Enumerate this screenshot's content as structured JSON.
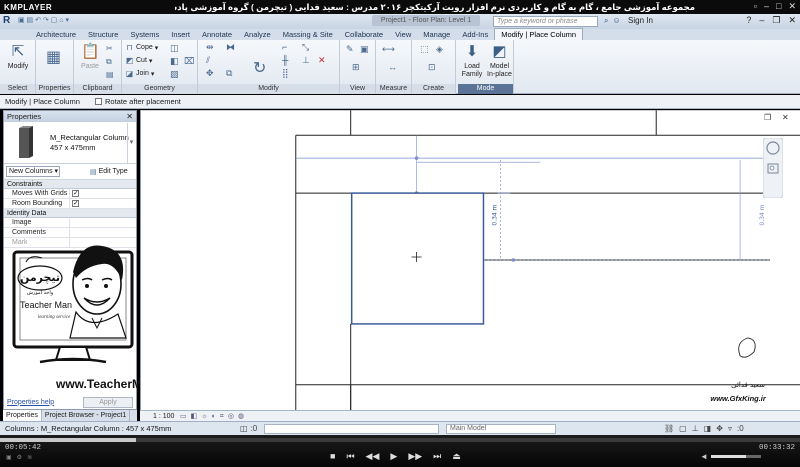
{
  "player": {
    "logo": "KMPLAYER",
    "caption": "مجموعه آموزشی جامع ، گام به گام و کاربردی نرم افزار رویت آرکیتکچر ۲۰۱۶ مدرس : سعید فدایی ( تیچرمن ) گروه آموزشی پادشاه گرافیست ها",
    "time_elapsed": "00:05:42",
    "time_total": "00:33:32",
    "progress_fraction": 0.17,
    "volume_fraction": 0.7
  },
  "revit": {
    "doc_tab": "Project1 - Floor Plan: Level 1",
    "search_placeholder": "Type a keyword or phrase",
    "sign_in": "Sign In",
    "tabs": [
      "Architecture",
      "Structure",
      "Systems",
      "Insert",
      "Annotate",
      "Analyze",
      "Massing & Site",
      "Collaborate",
      "View",
      "Manage",
      "Add-Ins",
      "Modify | Place Column"
    ],
    "panels": {
      "select": "Select",
      "properties": "Properties",
      "clipboard": "Clipboard",
      "geometry": "Geometry",
      "modify": "Modify",
      "view": "View",
      "measure": "Measure",
      "create": "Create",
      "mode": "Mode"
    },
    "buttons": {
      "modify": "Modify",
      "paste": "Paste",
      "cope": "Cope",
      "cut": "Cut",
      "join": "Join",
      "load_family": "Load Family",
      "model_inplace": "Model In-place"
    },
    "options_bar": {
      "context": "Modify | Place Column",
      "rotate_label": "Rotate after placement"
    },
    "properties": {
      "title": "Properties",
      "type_family": "M_Rectangular Column",
      "type_size": "457 x 475mm",
      "instance_selector": "New Columns",
      "edit_type": "Edit Type",
      "groups": [
        {
          "name": "Constraints",
          "rows": [
            {
              "key": "Moves With Grids",
              "checked": true
            },
            {
              "key": "Room Bounding",
              "checked": true
            }
          ]
        },
        {
          "name": "Identity Data",
          "rows": [
            {
              "key": "Image",
              "value": ""
            },
            {
              "key": "Comments",
              "value": ""
            },
            {
              "key": "Mark",
              "value": ""
            }
          ]
        }
      ],
      "help_link": "Properties help",
      "apply": "Apply"
    },
    "palette_tabs": [
      "Properties",
      "Project Browser - Project1"
    ],
    "view_scale": "1 : 100",
    "dimension_left": "0.34 m",
    "dimension_right": "0.34 m",
    "status_message": "Columns : M_Rectangular Column : 457 x 475mm",
    "workset": "Main Model"
  },
  "overlay": {
    "brand_fa": "تیچرمن",
    "brand_sub_fa": "واحد آموزش",
    "brand_en": "Teacher Man",
    "brand_tag": "learning service",
    "website": "www.TeacherMan.ir",
    "watermark_fa": "سعید فدائی",
    "watermark_site": "www.GfxKing.ir"
  },
  "colors": {
    "ribbon_accent": "#5a7396",
    "selection_blue": "#3b5a9a",
    "dimension_blue": "#7a8fd0"
  }
}
